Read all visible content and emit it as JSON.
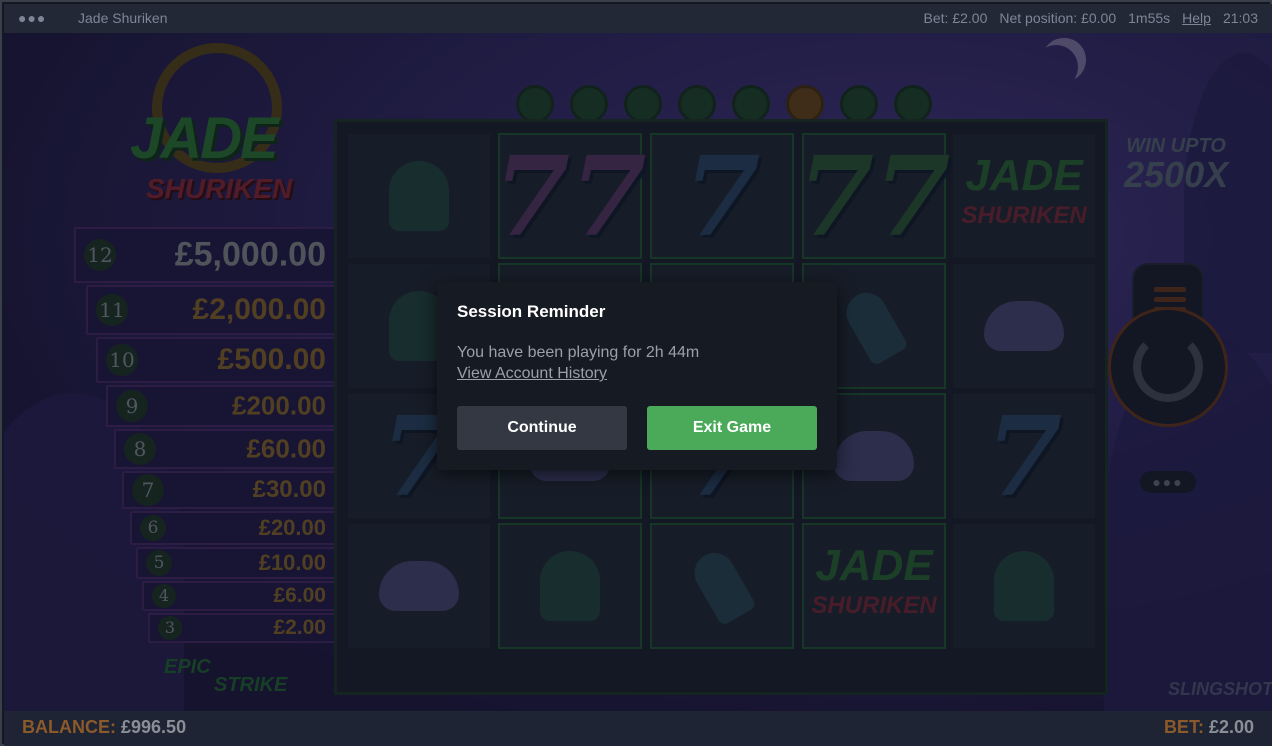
{
  "topbar": {
    "menu_icon": "more-dots",
    "title": "Jade Shuriken",
    "bet": "Bet: £2.00",
    "net_position": "Net position: £0.00",
    "session_time": "1m55s",
    "help": "Help",
    "clock": "21:03"
  },
  "logo": {
    "line1": "JADE",
    "line2": "SHURIKEN"
  },
  "ladder": [
    {
      "level": "12",
      "amount": "£5,000.00"
    },
    {
      "level": "11",
      "amount": "£2,000.00"
    },
    {
      "level": "10",
      "amount": "£500.00"
    },
    {
      "level": "9",
      "amount": "£200.00"
    },
    {
      "level": "8",
      "amount": "£60.00"
    },
    {
      "level": "7",
      "amount": "£30.00"
    },
    {
      "level": "6",
      "amount": "£20.00"
    },
    {
      "level": "5",
      "amount": "£10.00"
    },
    {
      "level": "4",
      "amount": "£6.00"
    },
    {
      "level": "3",
      "amount": "£2.00"
    }
  ],
  "epic_strike": {
    "line1": "EPIC",
    "line2": "STRIKE"
  },
  "win_upto": {
    "line1": "WIN UPTO",
    "line2": "2500X"
  },
  "reels": {
    "symbols": [
      [
        "bell",
        "bell",
        "seven-blue",
        "pot"
      ],
      [
        "seven-pink",
        "seven-blue",
        "pot",
        "bell"
      ],
      [
        "seven-blue",
        "seven-blue",
        "seven-blue",
        "bottle"
      ],
      [
        "seven-green",
        "bottle",
        "pot",
        "jade"
      ],
      [
        "jade",
        "pot",
        "seven-blue",
        "bell"
      ]
    ]
  },
  "controls": {
    "menu_icon": "hamburger",
    "spin_icon": "spin-arrow",
    "more_icon": "more-dots"
  },
  "provider": "SLINGSHOT",
  "bottombar": {
    "balance_label": "BALANCE:",
    "balance_value": "£996.50",
    "bet_label": "BET:",
    "bet_value": "£2.00"
  },
  "dialog": {
    "title": "Session Reminder",
    "message": "You have been playing for 2h 44m",
    "link": "View Account History",
    "continue": "Continue",
    "exit": "Exit Game"
  },
  "colors": {
    "exit_button": "#4aaa5a",
    "continue_button": "#343842",
    "dialog_bg": "#161a22"
  }
}
